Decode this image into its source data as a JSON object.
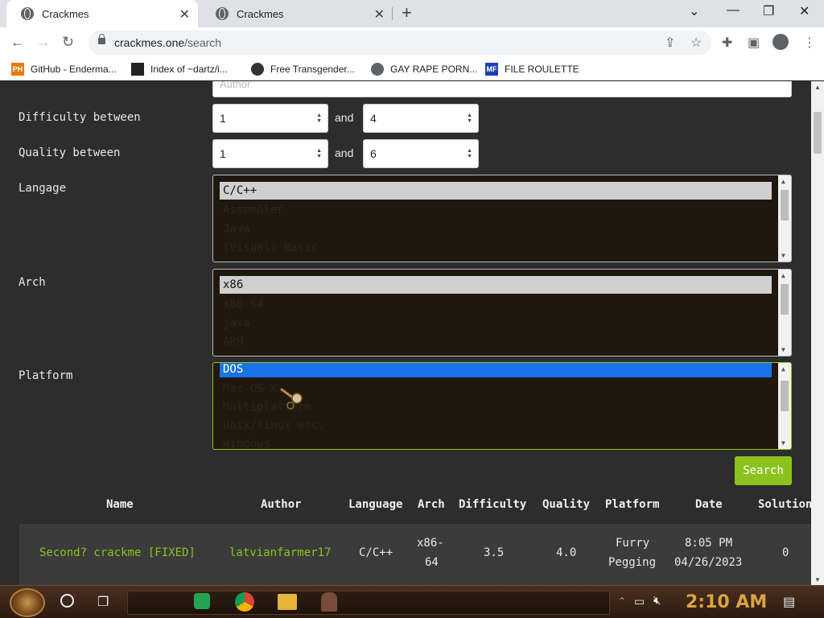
{
  "browser": {
    "tabs": [
      {
        "title": "Crackmes",
        "active": true
      },
      {
        "title": "Crackmes",
        "active": false
      }
    ],
    "url_host": "crackmes.one",
    "url_path": "/search",
    "bookmarks": [
      {
        "label": "GitHub - Enderma...",
        "icon": "ph-icon",
        "fav_text": "PH",
        "color": "#e8780a"
      },
      {
        "label": "Index of ~dartz/i...",
        "icon": "qr-icon",
        "fav_text": "",
        "color": "#222222"
      },
      {
        "label": "Free Transgender...",
        "icon": "skull-icon",
        "fav_text": "",
        "color": "#333333"
      },
      {
        "label": "GAY RAPE PORN...",
        "icon": "globe-icon",
        "fav_text": "",
        "color": "#5f6368"
      },
      {
        "label": "FILE ROULETTE",
        "icon": "mf-icon",
        "fav_text": "MF",
        "color": "#1a3fb0"
      }
    ]
  },
  "form": {
    "author_placeholder": "Author",
    "difficulty_label": "Difficulty between",
    "difficulty_min": "1",
    "difficulty_max": "4",
    "quality_label": "Quality between",
    "quality_min": "1",
    "quality_max": "6",
    "and_text": "and",
    "language_label": "Langage",
    "language_options": [
      "C/C++",
      "Assembler",
      "Java",
      "(Visual) Basic"
    ],
    "arch_label": "Arch",
    "arch_options": [
      "x86",
      "x86-64",
      "java",
      "ARM"
    ],
    "platform_label": "Platform",
    "platform_options": [
      "DOS",
      "Mac OS X",
      "Multiplatform",
      "Unix/linux etc.",
      "Windows"
    ],
    "search_label": "Search"
  },
  "results": {
    "headers": [
      "Name",
      "Author",
      "Language",
      "Arch",
      "Difficulty",
      "Quality",
      "Platform",
      "Date",
      "Solutions"
    ],
    "rows": [
      {
        "name": "Second? crackme [FIXED]",
        "author": "latvianfarmer17",
        "language": "C/C++",
        "arch_line1": "x86-",
        "arch_line2": "64",
        "difficulty": "3.5",
        "quality": "4.0",
        "platform_line1": "Furry",
        "platform_line2": "Pegging",
        "date_line1": "8:05 PM",
        "date_line2": "04/26/2023",
        "solutions": "0"
      }
    ]
  },
  "taskbar": {
    "clock": "2:10 AM"
  },
  "colors": {
    "accent": "#8cc21e",
    "page_bg": "#2d2d2d",
    "listbox_bg": "#20180f",
    "selected_blue": "#1a73e8"
  }
}
